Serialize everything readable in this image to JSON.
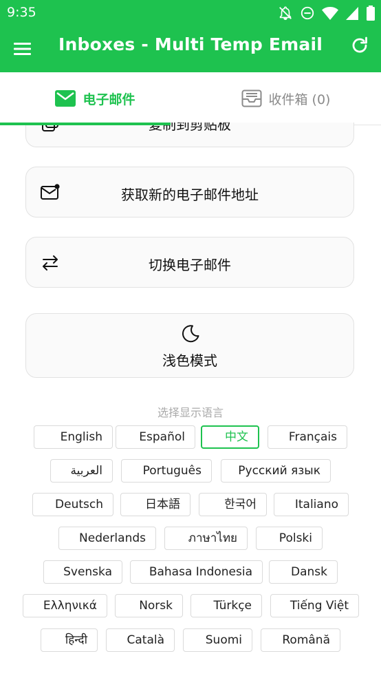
{
  "status_bar": {
    "time": "9:35",
    "icons": [
      "notifications-off-icon",
      "do-not-disturb-icon",
      "wifi-icon",
      "cell-signal-icon",
      "battery-icon"
    ]
  },
  "app_bar": {
    "title": "Inboxes - Multi Temp Email",
    "menu_icon": "hamburger-menu-icon",
    "refresh_icon": "refresh-icon"
  },
  "tabs": [
    {
      "label": "电子邮件",
      "icon": "envelope-icon",
      "active": true
    },
    {
      "label": "收件箱 (0)",
      "icon": "inbox-tray-icon",
      "active": false
    }
  ],
  "actions": {
    "copy_label": "复制到剪贴板",
    "new_email_label": "获取新的电子邮件地址",
    "switch_email_label": "切换电子邮件",
    "theme_label": "浅色模式"
  },
  "language_section": {
    "label": "选择显示语言",
    "selected": "中文",
    "languages": [
      "English",
      "Español",
      "中文",
      "Français",
      "العربية",
      "Português",
      "Русский язык",
      "Deutsch",
      "日本語",
      "한국어",
      "Italiano",
      "Nederlands",
      "ภาษาไทย",
      "Polski",
      "Svenska",
      "Bahasa Indonesia",
      "Dansk",
      "Ελληνικά",
      "Norsk",
      "Türkçe",
      "Tiếng Việt",
      "हिन्दी",
      "Català",
      "Suomi",
      "Română"
    ]
  },
  "colors": {
    "brand_green": "#1ec24f",
    "card_border": "#e2e2e2",
    "muted_text": "#aaaaaa"
  }
}
